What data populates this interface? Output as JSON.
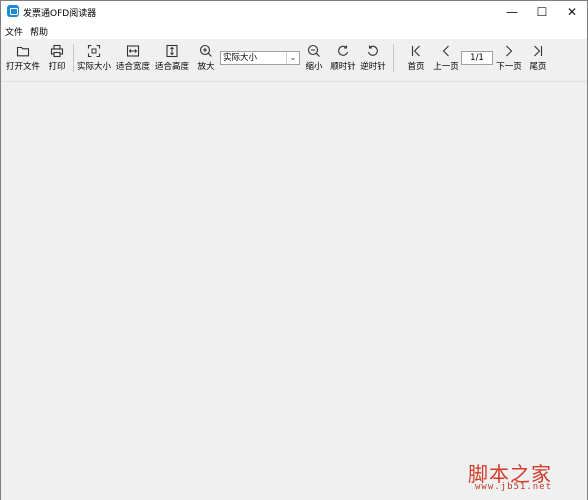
{
  "window": {
    "title": "发票通OFD阅读器",
    "min": "—",
    "max": "☐",
    "close": "✕"
  },
  "menu": [
    "文件",
    "帮助"
  ],
  "toolbar": {
    "open": "打开文件",
    "print": "打印",
    "actual_size": "实际大小",
    "fit_width": "适合宽度",
    "fit_height": "适合高度",
    "zoom_in": "放大",
    "zoom_value": "实际大小",
    "zoom_out": "缩小",
    "rotate_cw": "顺时针",
    "rotate_ccw": "逆时针",
    "first_page": "首页",
    "prev_page": "上一页",
    "page_indicator": "1/1",
    "next_page": "下一页",
    "last_page": "尾页"
  },
  "watermark": {
    "text": "脚本之家",
    "url": "www.jb51.net"
  }
}
